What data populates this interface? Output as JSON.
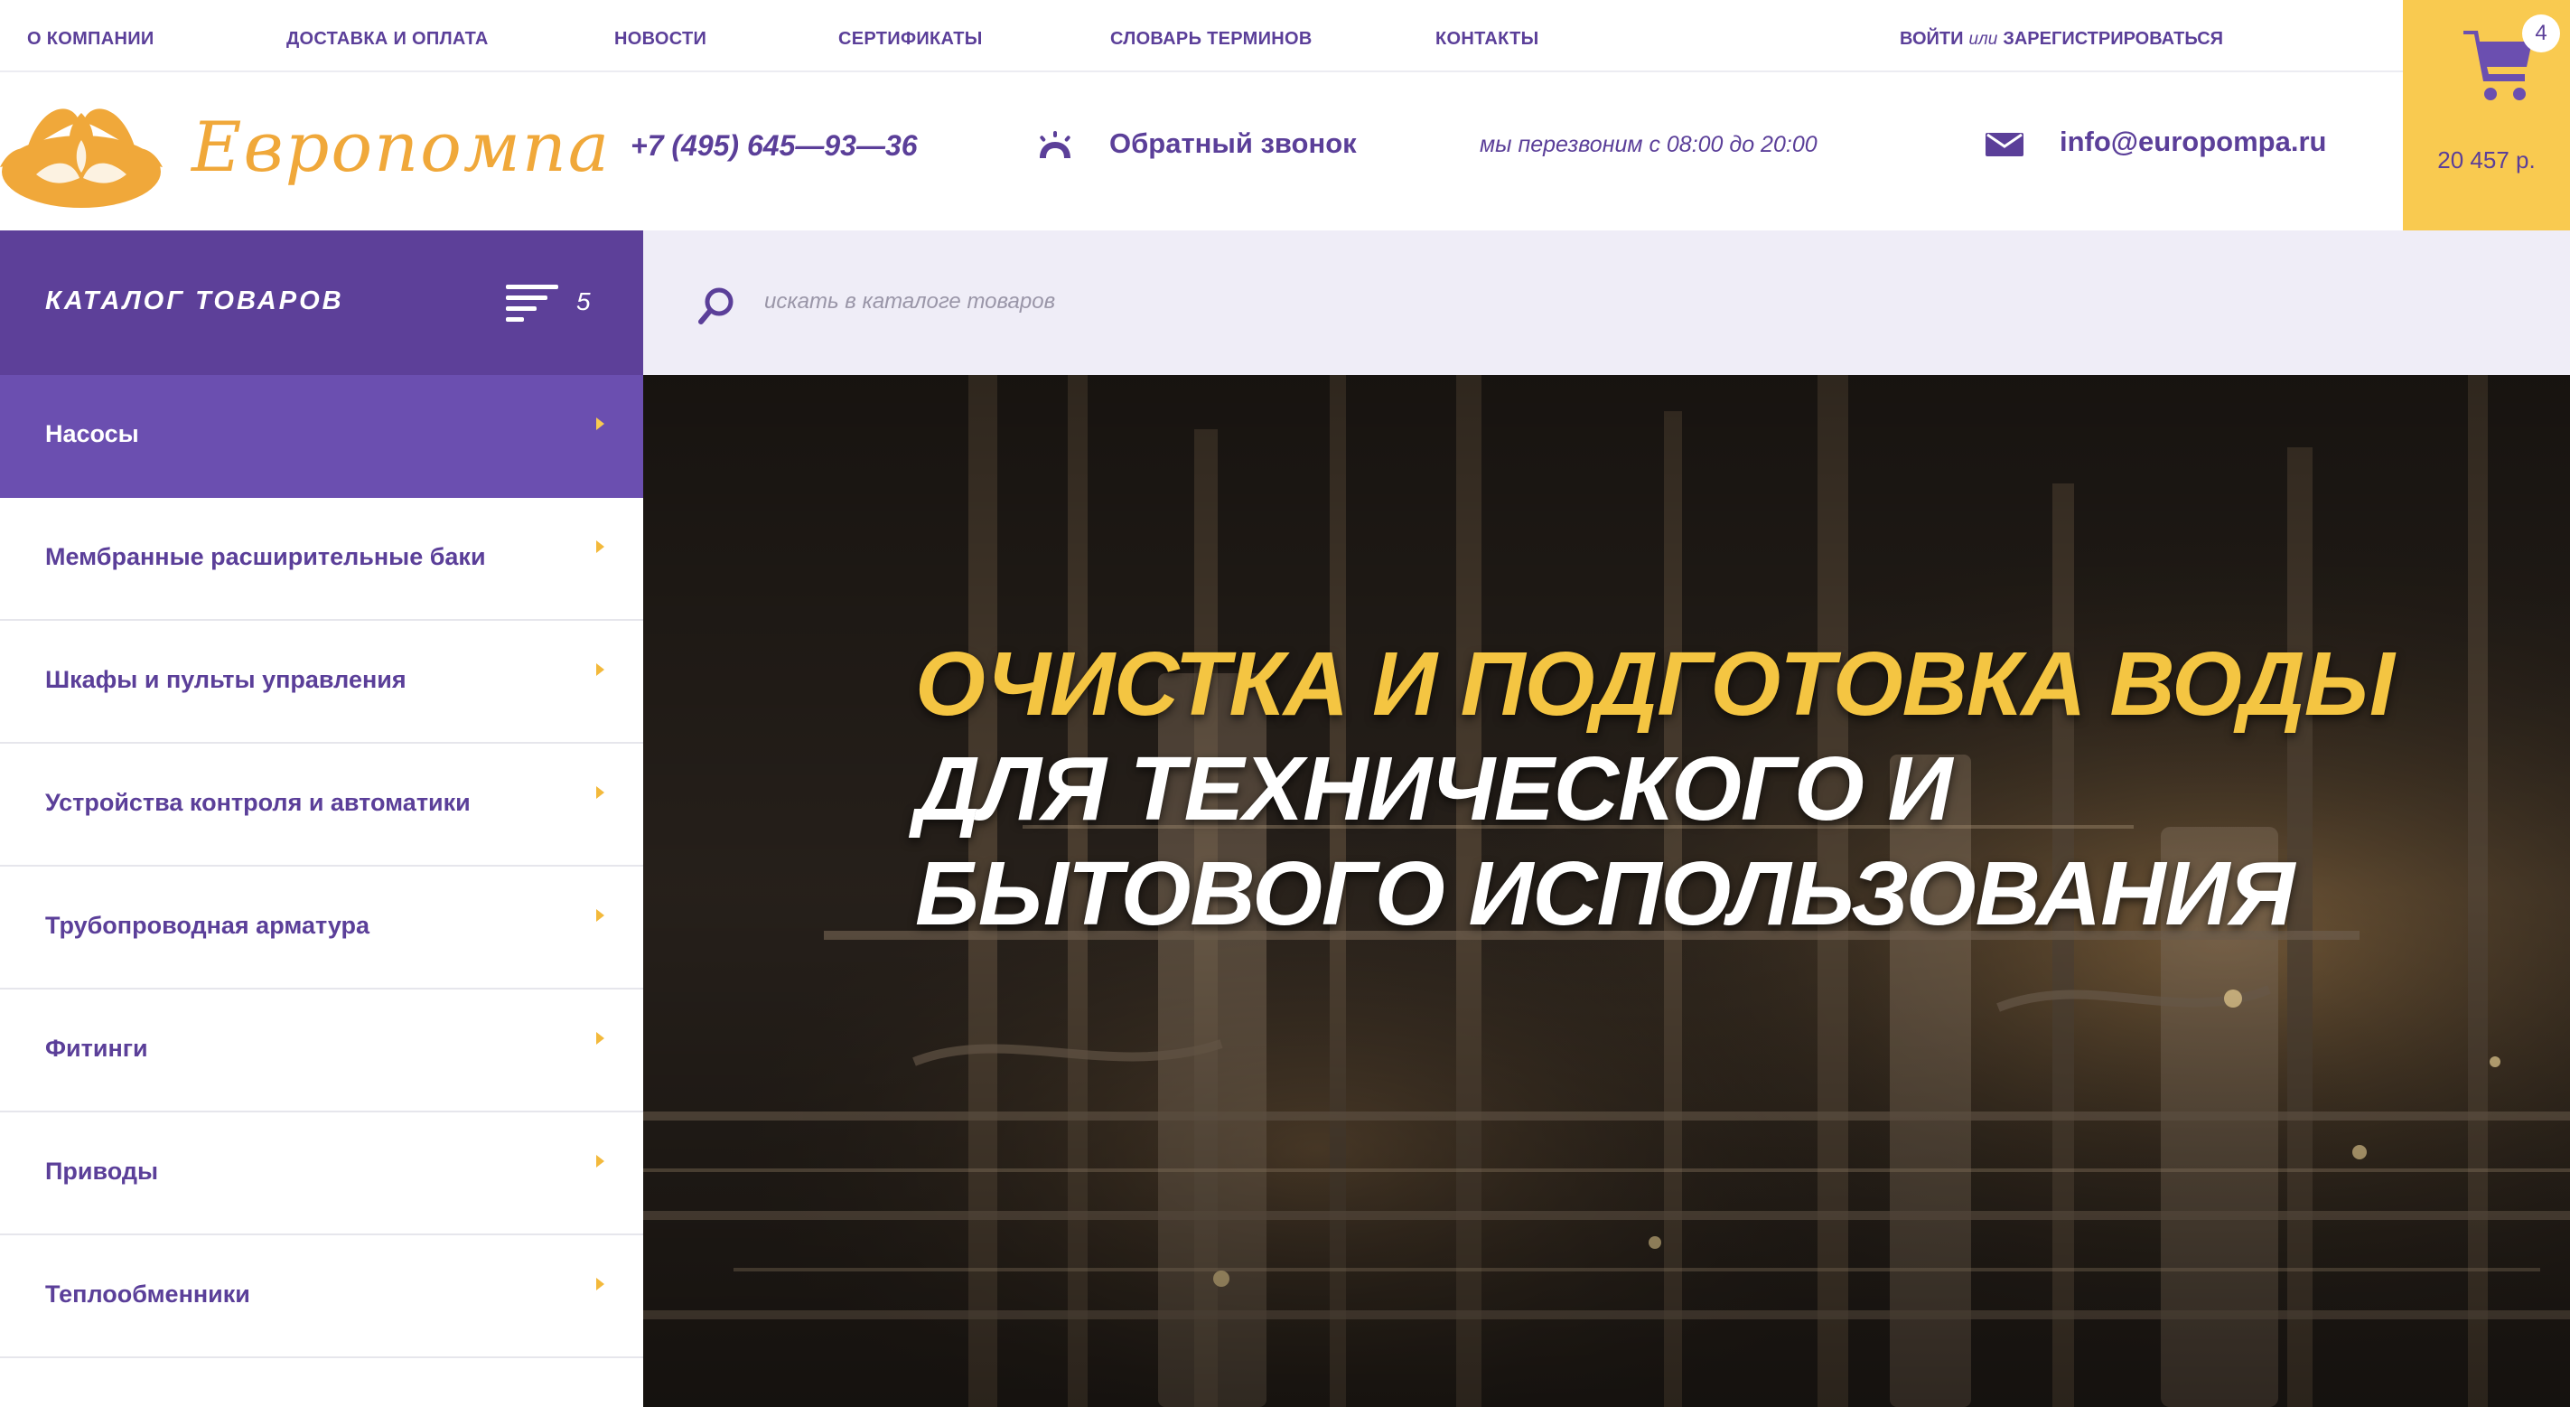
{
  "topnav": {
    "items": [
      "О КОМПАНИИ",
      "ДОСТАВКА И ОПЛАТА",
      "НОВОСТИ",
      "СЕРТИФИКАТЫ",
      "СЛОВАРЬ ТЕРМИНОВ",
      "КОНТАКТЫ"
    ],
    "login": "ВОЙТИ",
    "or": "или",
    "register": "ЗАРЕГИСТРИРОВАТЬСЯ"
  },
  "header": {
    "logo_text": "Европомпа",
    "phone": "+7 (495) 645—93—36",
    "callback_label": "Обратный звонок",
    "callback_hours": "мы перезвоним с 08:00 до 20:00",
    "email": "info@europompa.ru"
  },
  "cart": {
    "count": "4",
    "total": "20 457 р."
  },
  "catalog": {
    "title": "КАТАЛОГ ТОВАРОВ",
    "count": "5",
    "items": [
      {
        "label": "Насосы",
        "active": true
      },
      {
        "label": "Мембранные расширительные баки",
        "active": false
      },
      {
        "label": "Шкафы и пульты управления",
        "active": false
      },
      {
        "label": "Устройства контроля и автоматики",
        "active": false
      },
      {
        "label": "Трубопроводная арматура",
        "active": false
      },
      {
        "label": "Фитинги",
        "active": false
      },
      {
        "label": "Приводы",
        "active": false
      },
      {
        "label": "Теплообменники",
        "active": false
      }
    ]
  },
  "search": {
    "placeholder": "искать в каталоге товаров",
    "value": ""
  },
  "hero": {
    "line1": "ОЧИСТКА И ПОДГОТОВКА ВОДЫ",
    "line2": "ДЛЯ ТЕХНИЧЕСКОГО И",
    "line3": "БЫТОВОГО ИСПОЛЬЗОВАНИЯ"
  },
  "colors": {
    "brand_purple": "#5d4099",
    "active_purple": "#6b4fb0",
    "accent_yellow": "#f9ca50",
    "hero_yellow": "#f4c542",
    "logo_orange": "#f0a83a",
    "search_bg": "#efedf7"
  },
  "icons": [
    "lotus-logo-icon",
    "callback-signal-icon",
    "mail-icon",
    "cart-icon",
    "menu-lines-icon",
    "search-icon",
    "chevron-right-icon"
  ]
}
